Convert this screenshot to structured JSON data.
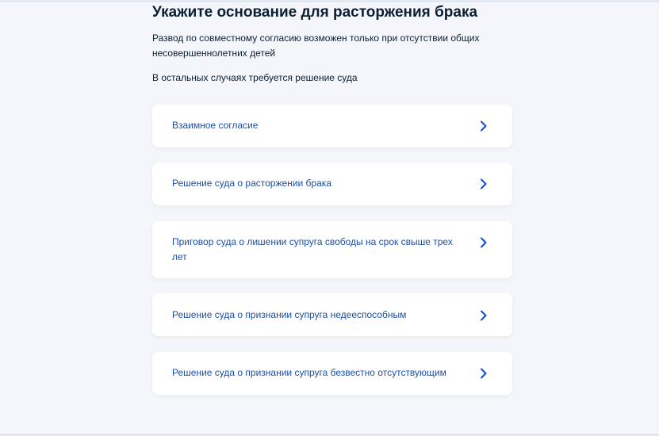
{
  "page": {
    "title": "Укажите основание для расторжения брака",
    "description_1": "Развод по совместному согласию возможен только при отсутствии общих несовершеннолетних детей",
    "description_2": "В остальных случаях требуется решение суда"
  },
  "options": [
    {
      "label": "Взаимное согласие"
    },
    {
      "label": "Решение суда о расторжении брака"
    },
    {
      "label": "Приговор суда о лишении супруга свободы на срок свыше трех лет"
    },
    {
      "label": "Решение суда о признании супруга недееспособным"
    },
    {
      "label": "Решение суда о признании супруга безвестно отсутствующим"
    }
  ],
  "colors": {
    "link": "#1a4fa8",
    "chevron": "#0d4cd3",
    "background": "#f4f6fb",
    "card": "#ffffff",
    "text": "#0b1f33"
  },
  "icons": {
    "option_arrow": "chevron-right-icon"
  }
}
